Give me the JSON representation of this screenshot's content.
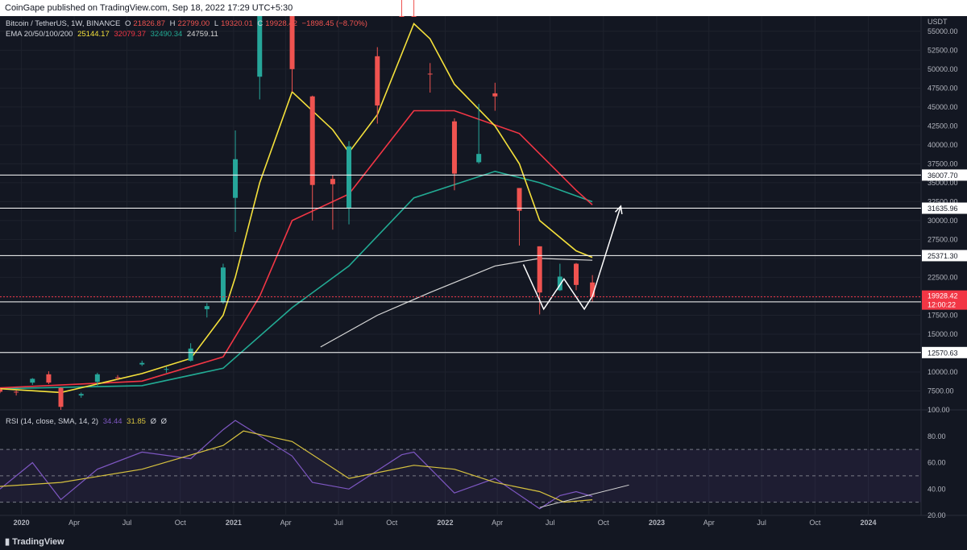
{
  "header": {
    "published": "CoinGape published on TradingView.com, Sep 18, 2022 17:29 UTC+5:30"
  },
  "legend": {
    "symbol": "Bitcoin / TetherUS, 1W, BINANCE",
    "ohlc": {
      "o_label": "O",
      "o": "21826.87",
      "h_label": "H",
      "h": "22799.00",
      "l_label": "L",
      "l": "19320.01",
      "c_label": "C",
      "c": "19928.42",
      "change": "−1898.45 (−8.70%)"
    },
    "ema_label": "EMA 20/50/100/200",
    "ema_values": [
      "25144.17",
      "32079.37",
      "32490.34",
      "24759.11"
    ],
    "rsi_label": "RSI (14, close, SMA, 14, 2)",
    "rsi_values": [
      "34.44",
      "31.85",
      "Ø",
      "Ø"
    ]
  },
  "colors": {
    "background": "#131722",
    "grid": "#1e222d",
    "up": "#26a69a",
    "down": "#ef5350",
    "ema20": "#f5e13b",
    "ema50": "#f23645",
    "ema100": "#22ab94",
    "ema200": "#d8d8d8",
    "rsi": "#7e57c2",
    "rsi_ma": "#d7c23f",
    "price_badge": "#f23645",
    "level": "#ffffff"
  },
  "price_axis": {
    "currency": "USDT",
    "ticks": [
      "55000.00",
      "52500.00",
      "50000.00",
      "47500.00",
      "45000.00",
      "42500.00",
      "40000.00",
      "37500.00",
      "35000.00",
      "32500.00",
      "30000.00",
      "27500.00",
      "25000.00",
      "22500.00",
      "20000.00",
      "17500.00",
      "15000.00",
      "12500.00",
      "10000.00",
      "7500.00"
    ],
    "last_price": "19928.42",
    "countdown": "12:00:22"
  },
  "rsi_axis": {
    "ticks": [
      "100.00",
      "80.00",
      "60.00",
      "40.00",
      "20.00"
    ]
  },
  "time_axis": {
    "labels": [
      "2020",
      "Apr",
      "Jul",
      "Oct",
      "2021",
      "Apr",
      "Jul",
      "Oct",
      "2022",
      "Apr",
      "Jul",
      "Oct",
      "2023",
      "Apr",
      "Jul",
      "Oct",
      "2024"
    ]
  },
  "levels": [
    {
      "value": 36007.7,
      "label": "36007.70"
    },
    {
      "value": 31635.96,
      "label": "31635.96"
    },
    {
      "value": 25371.3,
      "label": "25371.30"
    },
    {
      "value": 19265.36,
      "label": "19265.36"
    },
    {
      "value": 12570.63,
      "label": "12570.63"
    }
  ],
  "branding": {
    "name": "TradingView"
  },
  "chart_data": {
    "type": "candlestick",
    "interval": "1W",
    "ylim": [
      5000,
      57000
    ],
    "x_range": [
      "2019-11-25",
      "2024-04-01"
    ],
    "ohlc": [
      {
        "date": "2019-11-25",
        "o": 7700,
        "h": 7880,
        "l": 7200,
        "c": 7400
      },
      {
        "date": "2019-12-23",
        "o": 7400,
        "h": 7600,
        "l": 6900,
        "c": 7300
      },
      {
        "date": "2020-01-20",
        "o": 8600,
        "h": 9200,
        "l": 8300,
        "c": 9100
      },
      {
        "date": "2020-02-17",
        "o": 9700,
        "h": 10100,
        "l": 8400,
        "c": 8600
      },
      {
        "date": "2020-03-09",
        "o": 7900,
        "h": 8000,
        "l": 4000,
        "c": 5400
      },
      {
        "date": "2020-04-13",
        "o": 6900,
        "h": 7300,
        "l": 6600,
        "c": 7100
      },
      {
        "date": "2020-05-11",
        "o": 8700,
        "h": 9900,
        "l": 8200,
        "c": 9700
      },
      {
        "date": "2020-06-15",
        "o": 9300,
        "h": 9600,
        "l": 8900,
        "c": 9200
      },
      {
        "date": "2020-07-27",
        "o": 11000,
        "h": 11500,
        "l": 10800,
        "c": 11200
      },
      {
        "date": "2020-09-07",
        "o": 10300,
        "h": 10700,
        "l": 9900,
        "c": 10400
      },
      {
        "date": "2020-10-19",
        "o": 11500,
        "h": 13800,
        "l": 11400,
        "c": 13100
      },
      {
        "date": "2020-11-16",
        "o": 18300,
        "h": 19100,
        "l": 17200,
        "c": 18700
      },
      {
        "date": "2020-12-14",
        "o": 19200,
        "h": 24300,
        "l": 19000,
        "c": 23800
      },
      {
        "date": "2021-01-04",
        "o": 33000,
        "h": 41900,
        "l": 28500,
        "c": 38100
      },
      {
        "date": "2021-02-15",
        "o": 49000,
        "h": 58300,
        "l": 46000,
        "c": 57500
      },
      {
        "date": "2021-04-12",
        "o": 60000,
        "h": 64800,
        "l": 47000,
        "c": 50000
      },
      {
        "date": "2021-05-17",
        "o": 46400,
        "h": 46500,
        "l": 30000,
        "c": 34700
      },
      {
        "date": "2021-06-21",
        "o": 35500,
        "h": 36000,
        "l": 28800,
        "c": 34800
      },
      {
        "date": "2021-07-19",
        "o": 31700,
        "h": 40500,
        "l": 29500,
        "c": 39800
      },
      {
        "date": "2021-09-06",
        "o": 51700,
        "h": 52900,
        "l": 42800,
        "c": 45200
      },
      {
        "date": "2021-10-18",
        "o": 61500,
        "h": 67000,
        "l": 59500,
        "c": 61300
      },
      {
        "date": "2021-11-08",
        "o": 65000,
        "h": 69000,
        "l": 62300,
        "c": 64900
      },
      {
        "date": "2021-12-06",
        "o": 49400,
        "h": 50800,
        "l": 46900,
        "c": 49300
      },
      {
        "date": "2022-01-17",
        "o": 43100,
        "h": 43500,
        "l": 34000,
        "c": 36200
      },
      {
        "date": "2022-02-28",
        "o": 37700,
        "h": 45400,
        "l": 37500,
        "c": 38800
      },
      {
        "date": "2022-03-28",
        "o": 46800,
        "h": 48200,
        "l": 44500,
        "c": 46400
      },
      {
        "date": "2022-05-09",
        "o": 34300,
        "h": 34300,
        "l": 26700,
        "c": 31300
      },
      {
        "date": "2022-06-13",
        "o": 26600,
        "h": 26600,
        "l": 17600,
        "c": 20500
      },
      {
        "date": "2022-07-18",
        "o": 20800,
        "h": 24300,
        "l": 20700,
        "c": 22600
      },
      {
        "date": "2022-08-15",
        "o": 24300,
        "h": 24400,
        "l": 20800,
        "c": 21500
      },
      {
        "date": "2022-09-12",
        "o": 21826.87,
        "h": 22799.0,
        "l": 19320.01,
        "c": 19928.42
      }
    ],
    "ema20": [
      [
        "2019-11-25",
        7800
      ],
      [
        "2020-03-09",
        7300
      ],
      [
        "2020-07-27",
        9800
      ],
      [
        "2020-10-19",
        11800
      ],
      [
        "2020-12-14",
        17500
      ],
      [
        "2021-01-04",
        22500
      ],
      [
        "2021-02-15",
        35000
      ],
      [
        "2021-04-12",
        47000
      ],
      [
        "2021-06-21",
        42000
      ],
      [
        "2021-07-19",
        39000
      ],
      [
        "2021-09-06",
        44000
      ],
      [
        "2021-11-08",
        56000
      ],
      [
        "2021-12-06",
        54000
      ],
      [
        "2022-01-17",
        48000
      ],
      [
        "2022-03-28",
        42500
      ],
      [
        "2022-05-09",
        37500
      ],
      [
        "2022-06-13",
        30000
      ],
      [
        "2022-08-15",
        26000
      ],
      [
        "2022-09-12",
        25144.17
      ]
    ],
    "ema50": [
      [
        "2019-11-25",
        7900
      ],
      [
        "2020-07-27",
        8800
      ],
      [
        "2020-12-14",
        12000
      ],
      [
        "2021-02-15",
        20000
      ],
      [
        "2021-04-12",
        30000
      ],
      [
        "2021-07-19",
        33500
      ],
      [
        "2021-11-08",
        44500
      ],
      [
        "2022-01-17",
        44500
      ],
      [
        "2022-05-09",
        41500
      ],
      [
        "2022-08-15",
        34000
      ],
      [
        "2022-09-12",
        32079.37
      ]
    ],
    "ema100": [
      [
        "2019-11-25",
        7800
      ],
      [
        "2020-07-27",
        8200
      ],
      [
        "2020-12-14",
        10500
      ],
      [
        "2021-04-12",
        18500
      ],
      [
        "2021-07-19",
        24000
      ],
      [
        "2021-11-08",
        33000
      ],
      [
        "2022-03-28",
        36500
      ],
      [
        "2022-06-13",
        35000
      ],
      [
        "2022-09-12",
        32490.34
      ]
    ],
    "ema200": [
      [
        "2021-05-31",
        13300
      ],
      [
        "2021-09-06",
        17500
      ],
      [
        "2021-12-06",
        20500
      ],
      [
        "2022-03-28",
        24000
      ],
      [
        "2022-06-13",
        25000
      ],
      [
        "2022-09-12",
        24759.11
      ]
    ],
    "annotations": {
      "double_bottom": [
        [
          "2022-05-16",
          24200
        ],
        [
          "2022-06-20",
          18300
        ],
        [
          "2022-07-25",
          22300
        ],
        [
          "2022-08-29",
          18300
        ],
        [
          "2022-09-12",
          20000
        ]
      ],
      "breakout_arrow": [
        [
          "2022-09-12",
          20000
        ],
        [
          "2022-10-31",
          31900
        ]
      ]
    },
    "rsi": {
      "ylim": [
        20,
        100
      ],
      "band": [
        30,
        70
      ],
      "rsi14": [
        [
          "2019-11-25",
          40
        ],
        [
          "2020-01-20",
          60
        ],
        [
          "2020-03-09",
          32
        ],
        [
          "2020-05-11",
          55
        ],
        [
          "2020-07-27",
          68
        ],
        [
          "2020-10-19",
          63
        ],
        [
          "2020-12-14",
          85
        ],
        [
          "2021-01-04",
          92
        ],
        [
          "2021-04-12",
          65
        ],
        [
          "2021-05-17",
          45
        ],
        [
          "2021-07-19",
          40
        ],
        [
          "2021-10-18",
          66
        ],
        [
          "2021-11-08",
          68
        ],
        [
          "2022-01-17",
          37
        ],
        [
          "2022-03-28",
          48
        ],
        [
          "2022-06-13",
          25
        ],
        [
          "2022-07-18",
          35
        ],
        [
          "2022-08-15",
          38
        ],
        [
          "2022-09-12",
          34.44
        ]
      ],
      "rsi_ma": [
        [
          "2019-11-25",
          42
        ],
        [
          "2020-03-09",
          45
        ],
        [
          "2020-07-27",
          55
        ],
        [
          "2020-12-14",
          73
        ],
        [
          "2021-01-18",
          84
        ],
        [
          "2021-04-12",
          76
        ],
        [
          "2021-07-19",
          48
        ],
        [
          "2021-11-08",
          58
        ],
        [
          "2022-01-17",
          55
        ],
        [
          "2022-03-28",
          45
        ],
        [
          "2022-06-13",
          38
        ],
        [
          "2022-07-25",
          30
        ],
        [
          "2022-09-12",
          31.85
        ]
      ],
      "trendline": [
        [
          "2022-06-13",
          26
        ],
        [
          "2022-11-14",
          43
        ]
      ]
    }
  }
}
